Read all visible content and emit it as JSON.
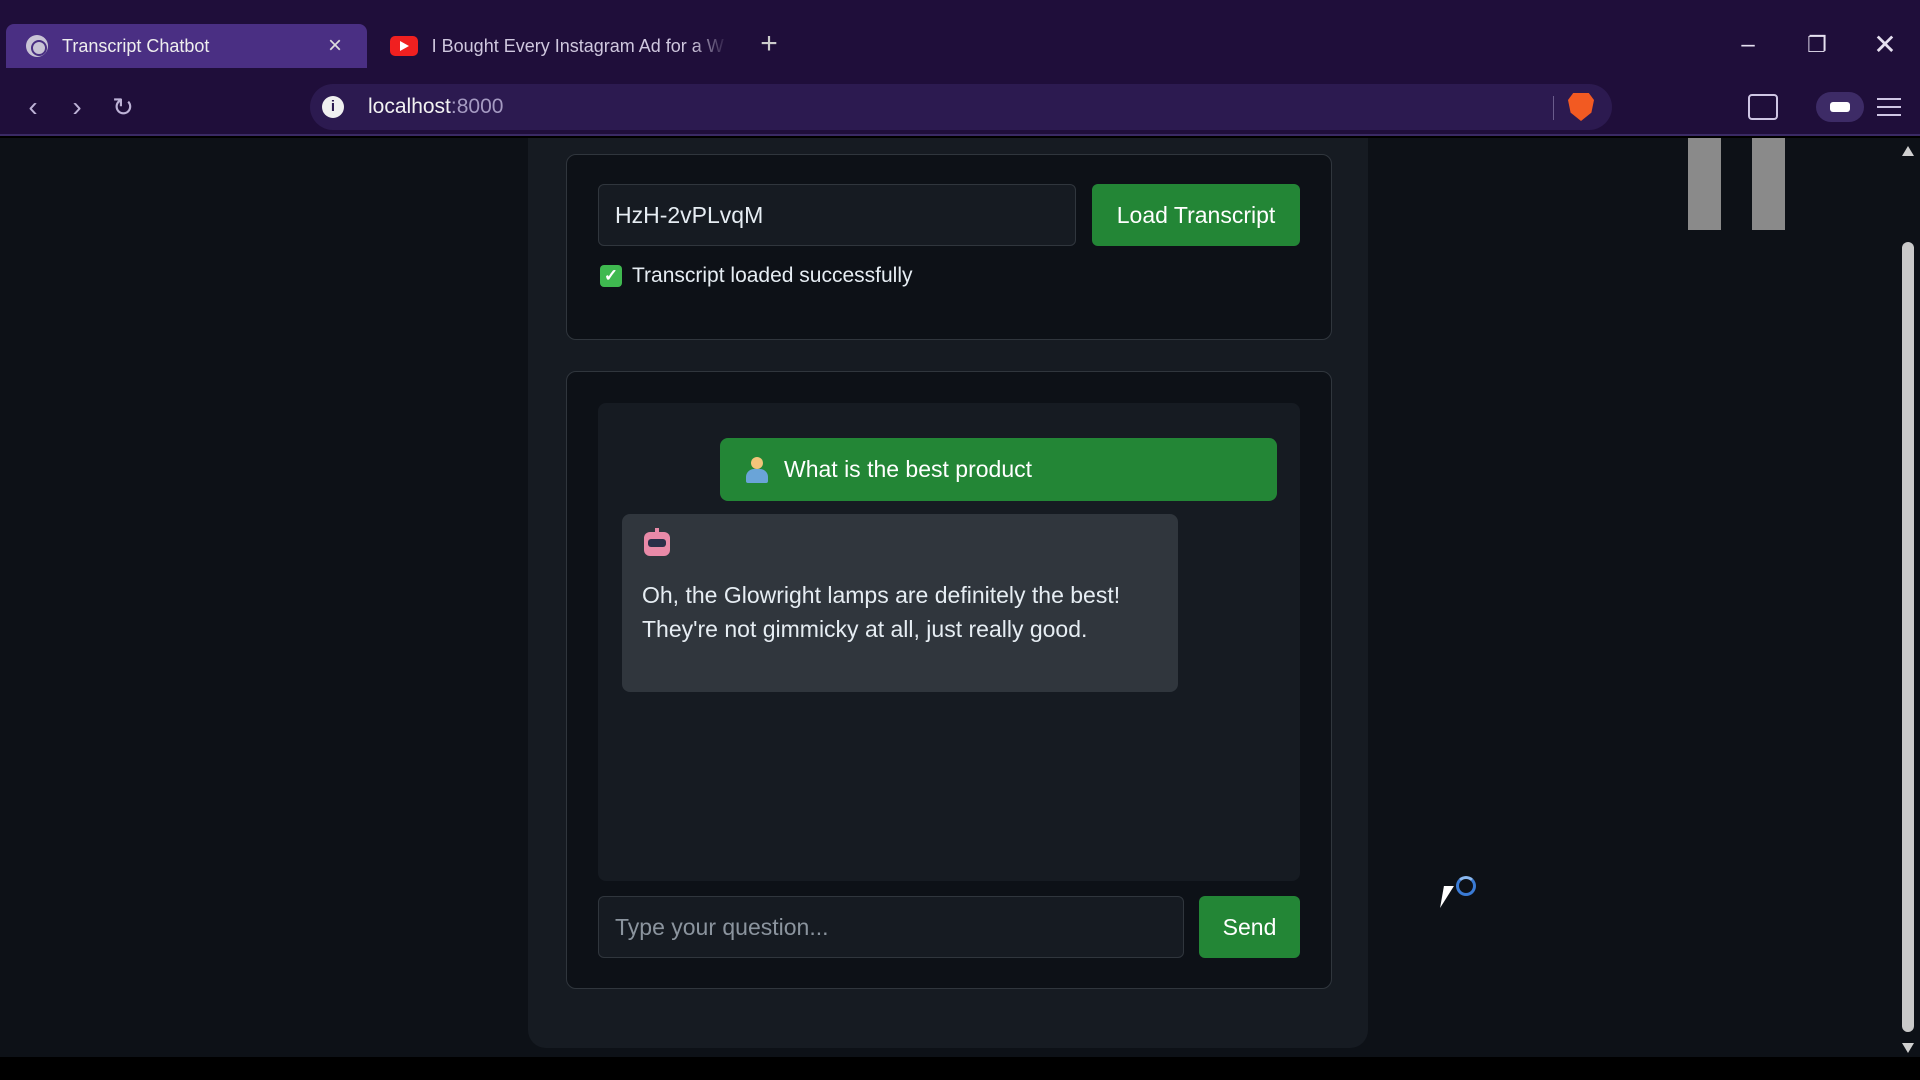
{
  "browser": {
    "tabs": [
      {
        "title": "Transcript Chatbot",
        "active": true
      },
      {
        "title": "I Bought Every Instagram Ad for a W",
        "active": false
      }
    ],
    "address": {
      "host": "localhost",
      "port": ":8000"
    }
  },
  "app": {
    "video_id_value": "HzH-2vPLvqM",
    "load_button_label": "Load Transcript",
    "status_text": "Transcript loaded successfully",
    "messages": [
      {
        "role": "user",
        "text": "What is the best product"
      },
      {
        "role": "bot",
        "text": "Oh, the Glowright lamps are definitely the best! They're not gimmicky at all, just really good."
      }
    ],
    "question_placeholder": "Type your question...",
    "send_button_label": "Send"
  },
  "colors": {
    "accent_green": "#238636",
    "browser_bg": "#1f0e3a",
    "page_bg": "#0d1117"
  }
}
